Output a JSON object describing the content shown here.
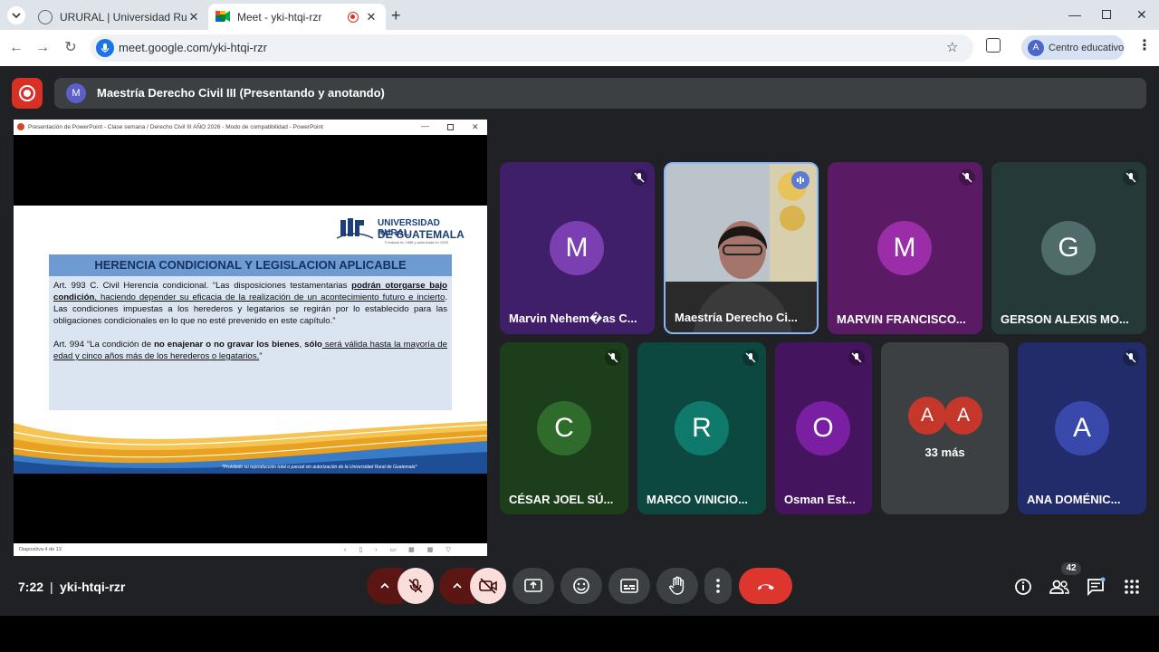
{
  "browser": {
    "tabs": [
      {
        "title": "URURAL | Universidad Rural de",
        "active": false
      },
      {
        "title": "Meet - yki-htqi-rzr",
        "active": true
      }
    ],
    "url": "meet.google.com/yki-htqi-rzr",
    "profile": {
      "initial": "A",
      "label": "Centro educativo"
    }
  },
  "meet": {
    "presenter": {
      "initial": "M",
      "title": "Maestría Derecho Civil III (Presentando y anotando)"
    },
    "ppt": {
      "window_title": "Presentación de PowerPoint - Clase semana / Derecho Civil III AÑO 2026 - Modo de compatibilidad - PowerPoint",
      "status": "Diapositiva 4 de 13",
      "logo_line1": "UNIVERSIDAD RURAL",
      "logo_line2": "DE GUATEMALA",
      "logo_line3": "Fundada en 1988 y autorizada en 1995",
      "slide_title": "HERENCIA CONDICIONAL Y LEGISLACION APLICABLE",
      "para1_a": "Art. 993 C. Civil Herencia condicional. “Las disposiciones testamentarias ",
      "para1_b": "podrán otorgarse bajo condición",
      "para1_c": ", haciendo depender su eficacia de la realización de un acontecimiento futuro e incierto",
      "para1_d": ". Las condiciones impuestas a los herederos y legatarios se regirán por lo establecido para las obligaciones condicionales en lo que no esté prevenido en este capítulo.”",
      "para2_a": "Art. 994 “La condición de ",
      "para2_b": "no enajenar o no gravar los bienes",
      "para2_c": ", ",
      "para2_d": "sólo",
      "para2_e": " será válida hasta la mayoría de edad y cinco años más de los herederos o legatarios.",
      "para2_f": "”",
      "footer": "*Prohibido su reproducción total o parcial sin autorización de la Universidad Rural de Guatemala*"
    },
    "participants_top": [
      {
        "name": "Marvin Nehem�as C...",
        "initial": "M",
        "color": "#7b3fb1",
        "bg": "#3f1f6a"
      },
      {
        "name": "Maestría Derecho Ci...",
        "video": true
      },
      {
        "name": "MARVIN FRANCISCO...",
        "initial": "M",
        "color": "#9b2ea8",
        "bg": "#5a1a64"
      },
      {
        "name": "GERSON ALEXIS MO...",
        "initial": "G",
        "color": "#4f6b6a",
        "bg": "#253939"
      }
    ],
    "participants_bottom": [
      {
        "name": "CÉSAR JOEL SÚ...",
        "initial": "C",
        "color": "#2f6b2a",
        "bg": "#1c3e1a"
      },
      {
        "name": "MARCO VINICIO...",
        "initial": "R",
        "color": "#0f7a6b",
        "bg": "#0d4840"
      },
      {
        "name": "Osman Est...",
        "initial": "O",
        "color": "#7b1fa2",
        "bg": "#45145e"
      },
      {
        "name": "ANA DOMÉNIC...",
        "initial": "A",
        "color": "#3949ab",
        "bg": "#232c6a"
      }
    ],
    "more": {
      "initials": [
        "A",
        "A"
      ],
      "label": "33 más"
    },
    "clock": "7:22",
    "separator": "|",
    "code": "yki-htqi-rzr",
    "people_count": "42"
  }
}
